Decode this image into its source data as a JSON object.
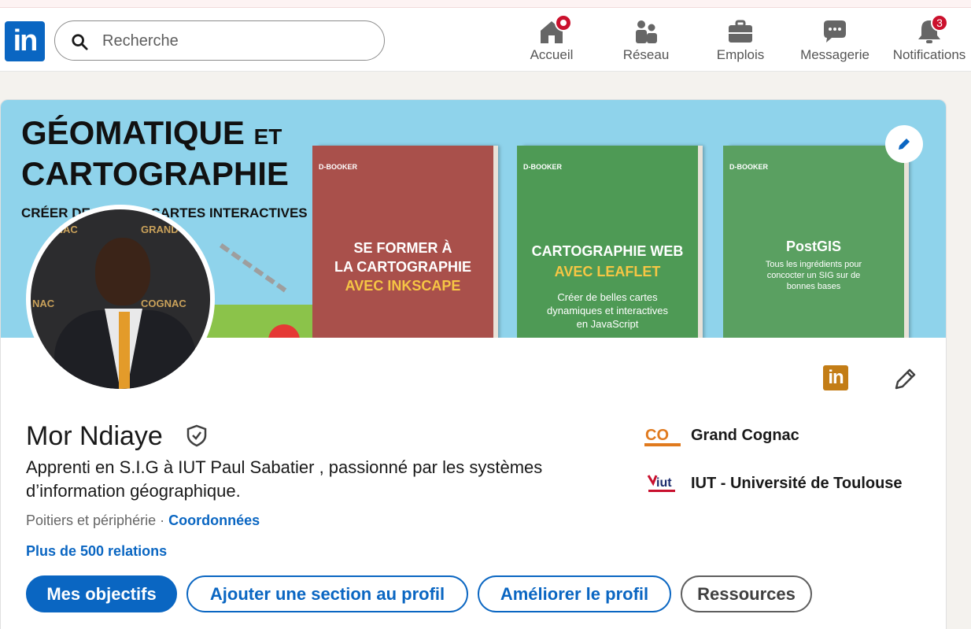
{
  "nav": {
    "logo": "in",
    "search_placeholder": "Recherche",
    "items": [
      {
        "label": "Accueil",
        "icon": "home-icon",
        "badge": ""
      },
      {
        "label": "Réseau",
        "icon": "network-icon",
        "badge": ""
      },
      {
        "label": "Emplois",
        "icon": "briefcase-icon",
        "badge": ""
      },
      {
        "label": "Messagerie",
        "icon": "messaging-icon",
        "badge": ""
      },
      {
        "label": "Notifications",
        "icon": "bell-icon",
        "badge": "3"
      }
    ]
  },
  "banner": {
    "title_line1": "GÉOMATIQUE",
    "title_et": "ET",
    "title_line2": "CARTOGRAPHIE",
    "subtitle": "CRÉER DE BELLES CARTES INTERACTIVES",
    "books": [
      {
        "publisher": "D-BOOKER",
        "line1": "SE FORMER À",
        "line2": "LA CARTOGRAPHIE",
        "line3": "AVEC INKSCAPE",
        "desc": ""
      },
      {
        "publisher": "D-BOOKER",
        "line1": "CARTOGRAPHIE WEB",
        "line2": "",
        "line3": "AVEC LEAFLET",
        "desc": "Créer de belles cartes dynamiques et interactives en JavaScript"
      },
      {
        "publisher": "D-BOOKER",
        "line1": "PostGIS",
        "line2": "",
        "line3": "",
        "desc": "Tous les ingrédients pour concocter un SIG sur de bonnes bases"
      }
    ]
  },
  "avatar_bg": {
    "brand1": "COGNAC",
    "brand2": "GRAND",
    "brand3": "NAC",
    "brand4": "COGNAC"
  },
  "profile": {
    "li_badge": "in",
    "name": "Mor Ndiaye",
    "headline": "Apprenti en S.I.G à IUT Paul Sabatier , passionné par les systèmes d’information géographique.",
    "location": "Poitiers et périphérie",
    "separator": " · ",
    "contact_link": "Coordonnées",
    "connections": "Plus de 500 relations"
  },
  "organizations": [
    {
      "name": "Grand Cognac",
      "logo_text": "CO",
      "icon": "grand-cognac-logo"
    },
    {
      "name": "IUT - Université de Toulouse",
      "logo_text": "iut",
      "icon": "iut-logo"
    }
  ],
  "actions": {
    "primary": "Mes objectifs",
    "add_section": "Ajouter une section au profil",
    "improve": "Améliorer le profil",
    "resources": "Ressources"
  },
  "colors": {
    "brand": "#0a66c2",
    "badge": "#cb112d",
    "banner_bg": "#8fd3eb"
  }
}
